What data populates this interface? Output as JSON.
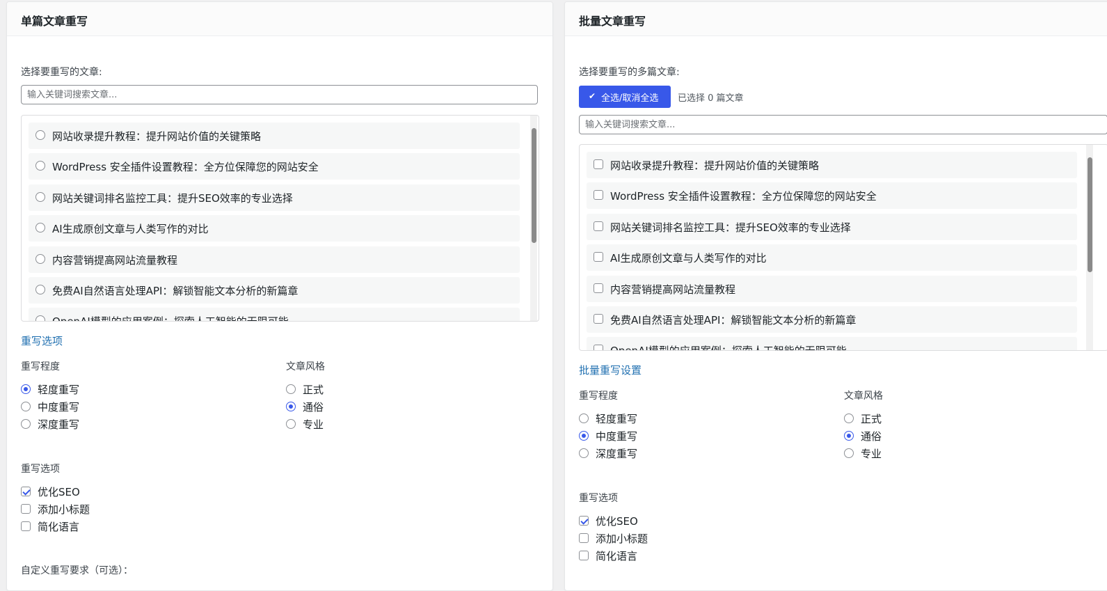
{
  "single": {
    "title": "单篇文章重写",
    "select_label": "选择要重写的文章:",
    "search_placeholder": "输入关键词搜索文章...",
    "articles": [
      "网站收录提升教程：提升网站价值的关键策略",
      "WordPress 安全插件设置教程：全方位保障您的网站安全",
      "网站关键词排名监控工具：提升SEO效率的专业选择",
      "AI生成原创文章与人类写作的对比",
      "内容营销提高网站流量教程",
      "免费AI自然语言处理API：解锁智能文本分析的新篇章",
      "OpenAI模型的应用案例：探索人工智能的无限可能"
    ],
    "rewrite_options_title": "重写选项",
    "degree_label": "重写程度",
    "degree_options": [
      "轻度重写",
      "中度重写",
      "深度重写"
    ],
    "degree_selected": "轻度重写",
    "style_label": "文章风格",
    "style_options": [
      "正式",
      "通俗",
      "专业"
    ],
    "style_selected": "通俗",
    "rewrite_checks_label": "重写选项",
    "rewrite_checks": [
      {
        "label": "优化SEO",
        "checked": true
      },
      {
        "label": "添加小标题",
        "checked": false
      },
      {
        "label": "简化语言",
        "checked": false
      }
    ],
    "custom_label": "自定义重写要求（可选）："
  },
  "batch": {
    "title": "批量文章重写",
    "select_label": "选择要重写的多篇文章:",
    "select_all_label": "全选/取消全选",
    "selected_count": "已选择 0 篇文章",
    "search_placeholder": "输入关键词搜索文章...",
    "articles": [
      "网站收录提升教程：提升网站价值的关键策略",
      "WordPress 安全插件设置教程：全方位保障您的网站安全",
      "网站关键词排名监控工具：提升SEO效率的专业选择",
      "AI生成原创文章与人类写作的对比",
      "内容营销提高网站流量教程",
      "免费AI自然语言处理API：解锁智能文本分析的新篇章",
      "OpenAI模型的应用案例：探索人工智能的无限可能"
    ],
    "settings_title": "批量重写设置",
    "degree_label": "重写程度",
    "degree_options": [
      "轻度重写",
      "中度重写",
      "深度重写"
    ],
    "degree_selected": "中度重写",
    "style_label": "文章风格",
    "style_options": [
      "正式",
      "通俗",
      "专业"
    ],
    "style_selected": "通俗",
    "rewrite_checks_label": "重写选项",
    "rewrite_checks": [
      {
        "label": "优化SEO",
        "checked": true
      },
      {
        "label": "添加小标题",
        "checked": false
      },
      {
        "label": "简化语言",
        "checked": false
      }
    ]
  },
  "colors": {
    "primary": "#3858e9",
    "link": "#2271b1",
    "background": "#f0f0f1"
  }
}
